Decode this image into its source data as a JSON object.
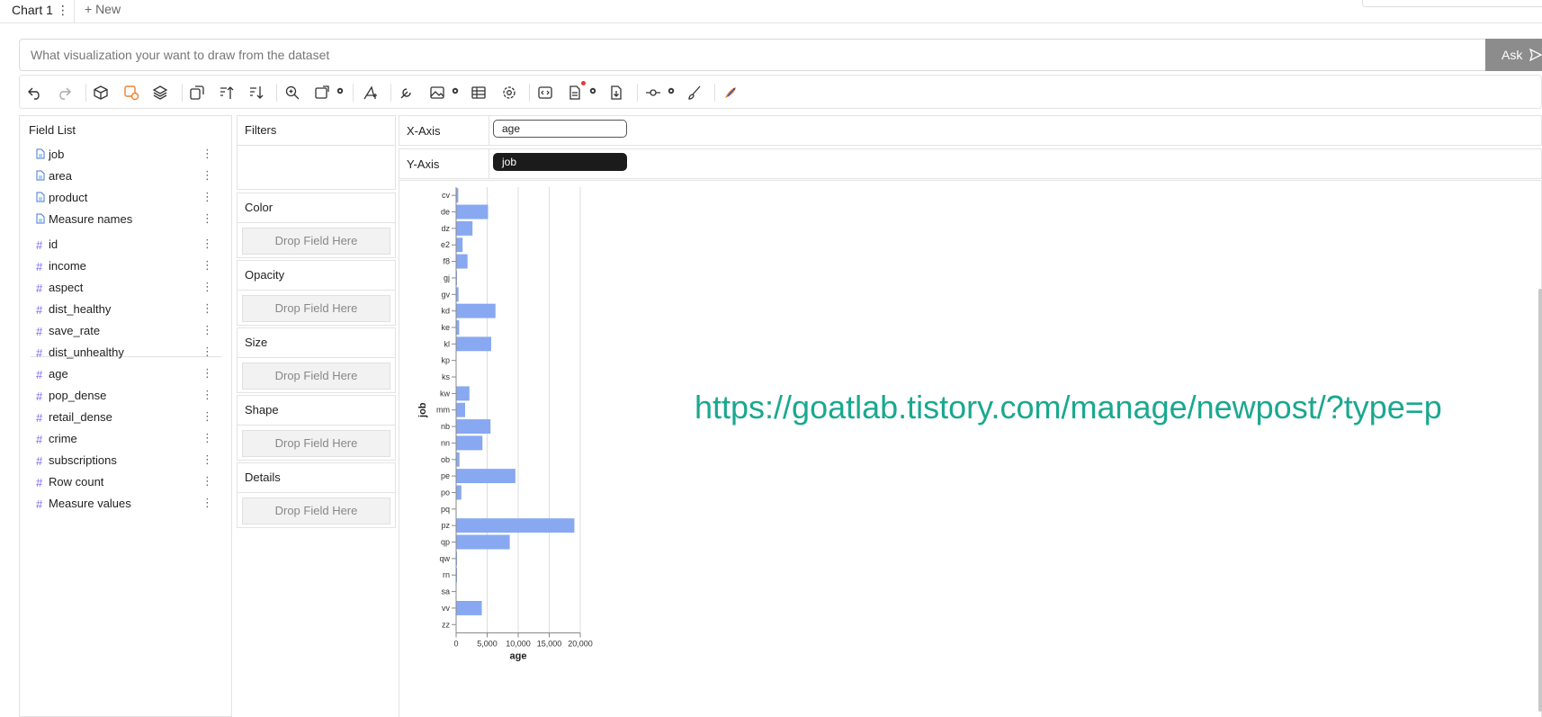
{
  "tabs": {
    "active_label": "Chart 1",
    "active_menu_glyph": "⋮",
    "new_label": "+ New"
  },
  "ask": {
    "placeholder": "What visualization your want to draw from the dataset",
    "button_label": "Ask",
    "button_icon": "send-icon"
  },
  "toolbar": {
    "icons": [
      "undo-icon",
      "redo-icon",
      "cube-icon",
      "layer-select-icon",
      "layers-icon",
      "transpose-icon",
      "sort-ascending-icon",
      "sort-descending-icon",
      "zoom-icon",
      "resize-icon",
      "brush-icon",
      "wrench-icon",
      "image-icon",
      "table-icon",
      "settings-icon",
      "code-icon",
      "export-icon",
      "download-icon",
      "commit-icon",
      "paint-brush-icon",
      "kanaries-logo-icon"
    ]
  },
  "field_list": {
    "title": "Field List",
    "dimensions": [
      "job",
      "area",
      "product",
      "Measure names"
    ],
    "measures": [
      "id",
      "income",
      "aspect",
      "dist_healthy",
      "save_rate",
      "dist_unhealthy",
      "age",
      "pop_dense",
      "retail_dense",
      "crime",
      "subscriptions",
      "Row count",
      "Measure values"
    ],
    "dimension_icon": "📄",
    "measure_icon": "#",
    "menu_glyph": "⋮"
  },
  "encodings": {
    "filters": "Filters",
    "color": "Color",
    "opacity": "Opacity",
    "size": "Size",
    "shape": "Shape",
    "details": "Details",
    "drop_text": "Drop Field Here"
  },
  "shelves": {
    "x_label": "X-Axis",
    "x_field": "age",
    "y_label": "Y-Axis",
    "y_field": "job"
  },
  "watermark": "https://goatlab.tistory.com/manage/newpost/?type=p",
  "colors": {
    "bar": "#88a9f2",
    "accent_orange": "#f0812a",
    "watermark": "#1aa88f",
    "ask_button": "#8c8c8c"
  },
  "chart_data": {
    "type": "bar",
    "orientation": "horizontal",
    "categories": [
      "cv",
      "de",
      "dz",
      "e2",
      "f8",
      "gj",
      "gv",
      "kd",
      "ke",
      "kl",
      "kp",
      "ks",
      "kw",
      "mm",
      "nb",
      "nn",
      "ob",
      "pe",
      "po",
      "pq",
      "pz",
      "qp",
      "qw",
      "rn",
      "sa",
      "vv",
      "zz"
    ],
    "values": [
      300,
      5100,
      2600,
      1000,
      1800,
      100,
      350,
      6300,
      450,
      5600,
      0,
      0,
      2100,
      1400,
      5500,
      4200,
      500,
      9500,
      800,
      0,
      19000,
      8600,
      100,
      100,
      0,
      4100,
      0
    ],
    "xlabel": "age",
    "ylabel": "job",
    "xlim": [
      0,
      20000
    ],
    "xticks": [
      "0",
      "5,000",
      "10,000",
      "15,000",
      "20,000"
    ],
    "grid": true
  }
}
